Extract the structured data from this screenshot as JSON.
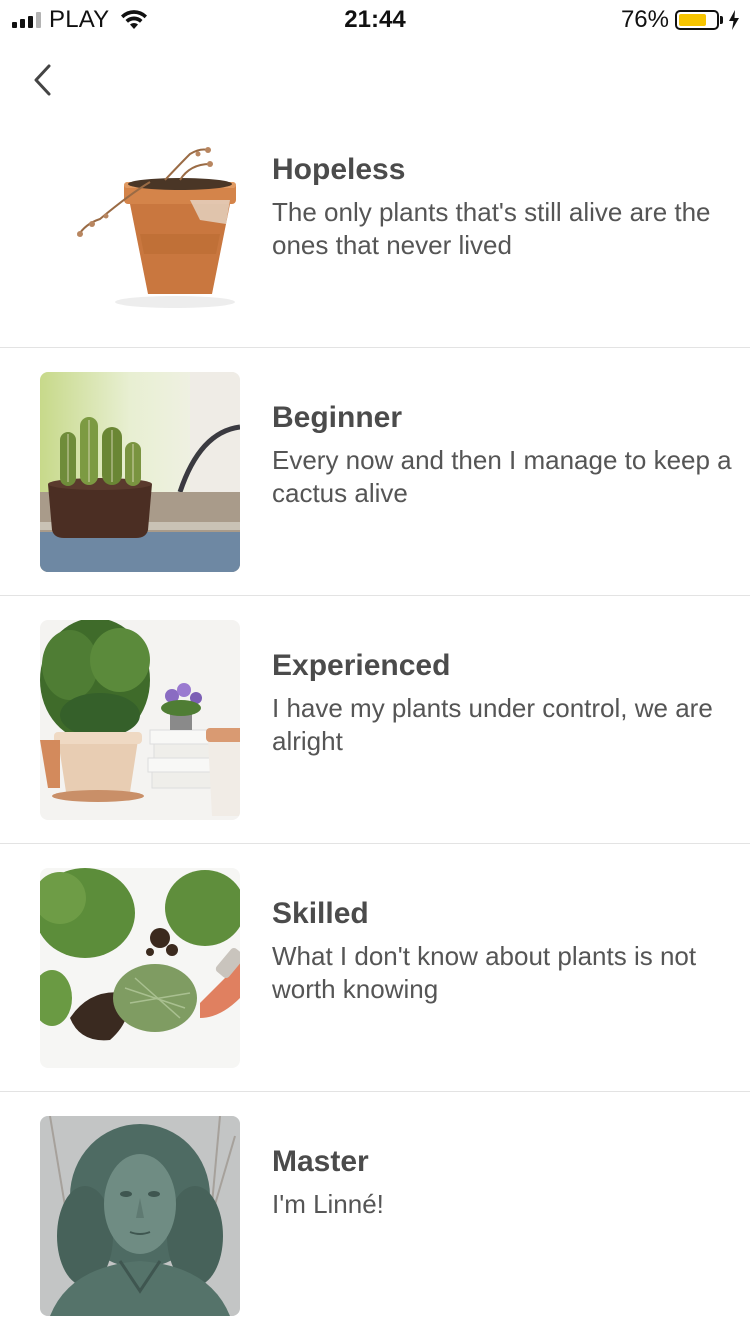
{
  "status_bar": {
    "carrier": "PLAY",
    "time": "21:44",
    "battery_percent": "76%",
    "battery_level": 0.76,
    "signal_bars_filled": 3,
    "signal_bars_total": 4,
    "icons": [
      "signal-icon",
      "wifi-icon",
      "battery-icon",
      "charging-bolt-icon"
    ]
  },
  "nav": {
    "back_icon": "chevron-left-icon"
  },
  "levels": [
    {
      "title": "Hopeless",
      "description": "The only plants that's still alive are the ones that never lived",
      "image": "dead-plant-pot-image"
    },
    {
      "title": "Beginner",
      "description": "Every now and then I manage to keep a cactus alive",
      "image": "cactus-pot-image"
    },
    {
      "title": "Experienced",
      "description": "I have my plants under control, we are alright",
      "image": "potted-plants-image"
    },
    {
      "title": "Skilled",
      "description": "What I don't know about plants is not worth knowing",
      "image": "repotting-herbs-image"
    },
    {
      "title": "Master",
      "description": "I'm Linné!",
      "image": "linne-statue-image"
    }
  ],
  "colors": {
    "battery_fill": "#f6c400",
    "divider": "#e3e3e3",
    "title_text": "#4b4b4b",
    "description_text": "#555555"
  }
}
